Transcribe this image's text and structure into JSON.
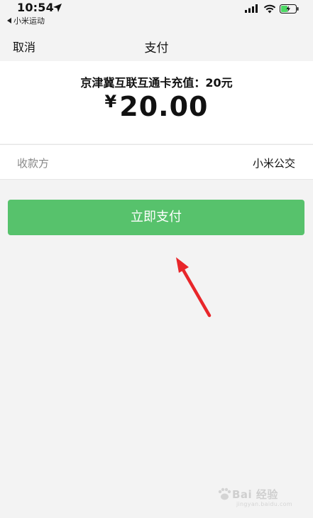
{
  "status_bar": {
    "time": "10:54",
    "back_app": "小米运动",
    "icons": [
      "location-arrow-icon",
      "cellular-signal-icon",
      "wifi-icon",
      "battery-charging-icon"
    ]
  },
  "nav": {
    "cancel_label": "取消",
    "title": "支付"
  },
  "order": {
    "product": "京津冀互联互通卡充值：20元",
    "currency_symbol": "¥",
    "amount": "20.00"
  },
  "payee": {
    "label": "收款方",
    "value": "小米公交"
  },
  "pay_button": {
    "label": "立即支付",
    "color": "#57c26c"
  },
  "annotation": {
    "arrow_color": "#e8262a"
  },
  "watermark": {
    "text": "Bai 经验",
    "sub": "jingyan.baidu.com"
  }
}
